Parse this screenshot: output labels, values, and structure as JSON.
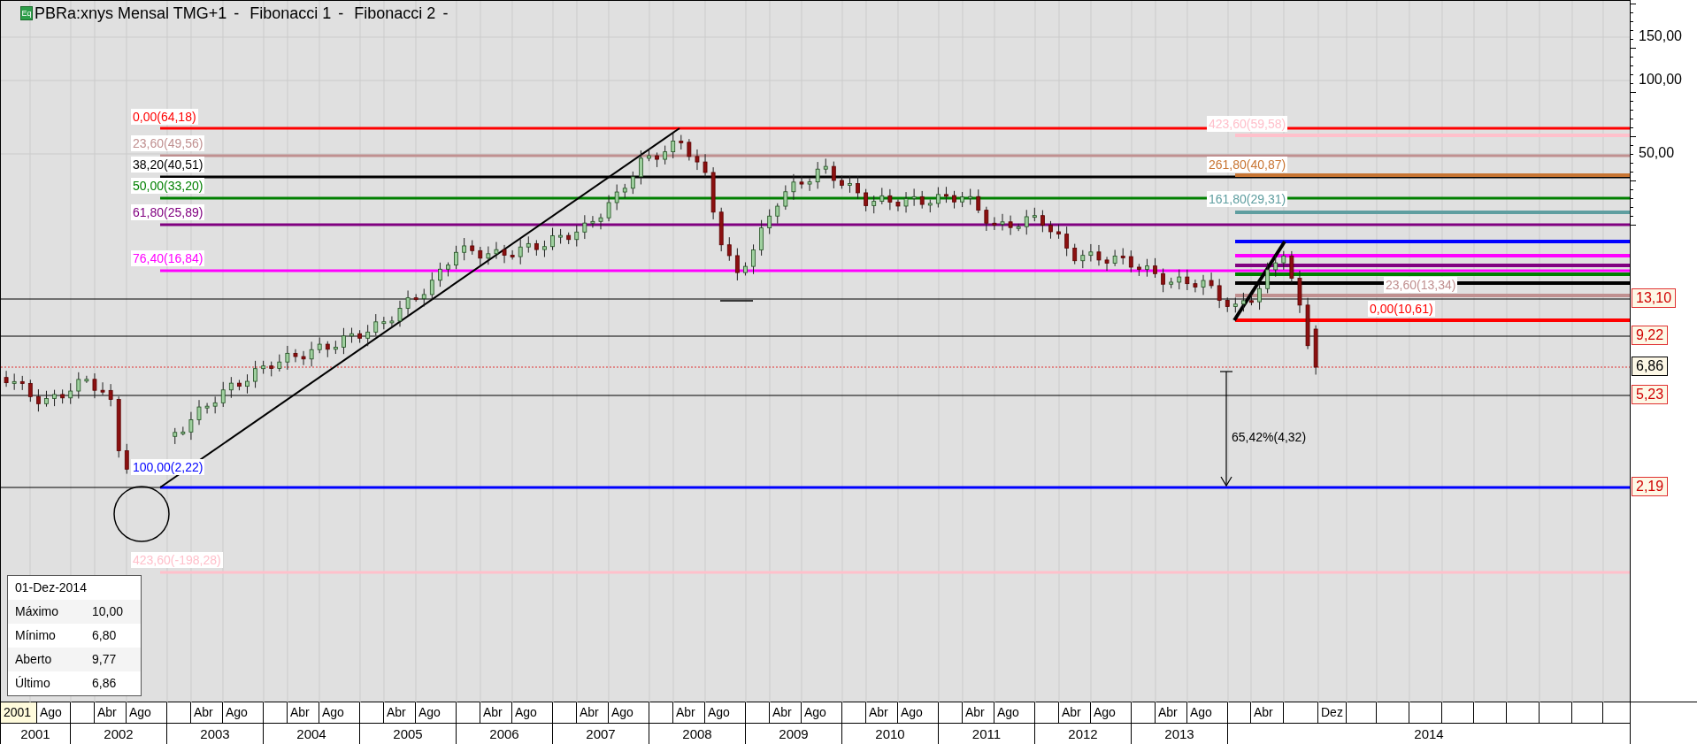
{
  "chart_header": {
    "icon_label": "Eq",
    "items": [
      {
        "label": "PBRa:xnys Mensal TMG+1",
        "caret": "-"
      },
      {
        "label": "Fibonacci 1",
        "caret": "-"
      },
      {
        "label": "Fibonacci 2",
        "caret": "-"
      }
    ]
  },
  "fibonacci_1": {
    "levels": [
      {
        "label": "0,00(64,18)",
        "color": "#ff0000"
      },
      {
        "label": "23,60(49,56)",
        "color": "#c09090"
      },
      {
        "label": "38,20(40,51)",
        "color": "#000000"
      },
      {
        "label": "50,00(33,20)",
        "color": "#008000"
      },
      {
        "label": "61,80(25,89)",
        "color": "#800080"
      },
      {
        "label": "76,40(16,84)",
        "color": "#ff00ff"
      },
      {
        "label": "100,00(2,22)",
        "color": "#0000ff"
      },
      {
        "label": "423,60(-198,28)",
        "color": "#ffc0cb"
      }
    ]
  },
  "fibonacci_2": {
    "levels": [
      {
        "label": "423,60(59,58)",
        "color": "#ffc0cb"
      },
      {
        "label": "261,80(40,87)",
        "color": "#c87533"
      },
      {
        "label": "161,80(29,31)",
        "color": "#5f9ea0"
      },
      {
        "color": "#0000ff"
      },
      {
        "color": "#ff00ff"
      },
      {
        "color": "#800080"
      },
      {
        "color": "#008000"
      },
      {
        "color": "#000000"
      },
      {
        "label": "23,60(13,34)",
        "color": "#c09090"
      },
      {
        "label": "0,00(10,61)",
        "color": "#ff0000"
      }
    ]
  },
  "measurement": {
    "label": "65,42%(4,32)"
  },
  "price_axis": {
    "ticks": [
      "150,00",
      "100,00",
      "50,00"
    ],
    "tags": [
      {
        "label": "13,10",
        "kind": "line"
      },
      {
        "label": "9,22",
        "kind": "line"
      },
      {
        "label": "6,86",
        "kind": "last"
      },
      {
        "label": "5,23",
        "kind": "line"
      },
      {
        "label": "2,19",
        "kind": "line"
      }
    ]
  },
  "info_box": {
    "date": "01-Dez-2014",
    "rows": [
      {
        "name": "Máximo",
        "value": "10,00"
      },
      {
        "name": "Mínimo",
        "value": "6,80"
      },
      {
        "name": "Aberto",
        "value": "9,77"
      },
      {
        "name": "Último",
        "value": "6,86"
      }
    ]
  },
  "time_axis": {
    "months": [
      {
        "label": "2001",
        "highlighted": true
      },
      {
        "label": "Ago",
        "highlighted": false
      },
      {
        "label": "Abr",
        "highlighted": false
      },
      {
        "label": "Ago",
        "highlighted": false
      },
      {
        "label": "Abr",
        "highlighted": false
      },
      {
        "label": "Ago",
        "highlighted": false
      },
      {
        "label": "Abr",
        "highlighted": false
      },
      {
        "label": "Ago",
        "highlighted": false
      },
      {
        "label": "Abr",
        "highlighted": false
      },
      {
        "label": "Ago",
        "highlighted": false
      },
      {
        "label": "Abr",
        "highlighted": false
      },
      {
        "label": "Ago",
        "highlighted": false
      },
      {
        "label": "Abr",
        "highlighted": false
      },
      {
        "label": "Ago",
        "highlighted": false
      },
      {
        "label": "Abr",
        "highlighted": false
      },
      {
        "label": "Ago",
        "highlighted": false
      },
      {
        "label": "Abr",
        "highlighted": false
      },
      {
        "label": "Ago",
        "highlighted": false
      },
      {
        "label": "Abr",
        "highlighted": false
      },
      {
        "label": "Ago",
        "highlighted": false
      },
      {
        "label": "Abr",
        "highlighted": false
      },
      {
        "label": "Ago",
        "highlighted": false
      },
      {
        "label": "Abr",
        "highlighted": false
      },
      {
        "label": "Ago",
        "highlighted": false
      },
      {
        "label": "Abr",
        "highlighted": false
      },
      {
        "label": "Ago",
        "highlighted": false
      },
      {
        "label": "Abr",
        "highlighted": false
      },
      {
        "label": "Dez",
        "highlighted": false
      }
    ],
    "years": [
      "2001",
      "2002",
      "2003",
      "2004",
      "2005",
      "2006",
      "2007",
      "2008",
      "2009",
      "2010",
      "2011",
      "2012",
      "2013",
      "2014"
    ]
  }
}
